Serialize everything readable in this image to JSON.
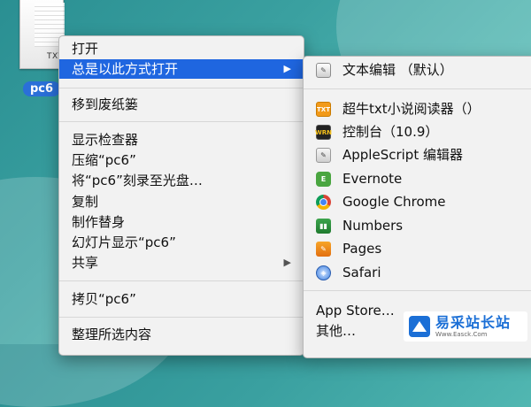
{
  "desktop": {
    "file_ext": "TXT",
    "file_label": "pc6"
  },
  "context_menu": {
    "items": [
      {
        "label": "打开"
      },
      {
        "label": "总是以此方式打开",
        "has_submenu": true,
        "active": true
      },
      {
        "label": "移到废纸篓"
      },
      {
        "label": "显示检查器"
      },
      {
        "label": "压缩“pc6”"
      },
      {
        "label": "将“pc6”刻录至光盘…"
      },
      {
        "label": "复制"
      },
      {
        "label": "制作替身"
      },
      {
        "label": "幻灯片显示“pc6”"
      },
      {
        "label": "共享",
        "has_submenu": true
      },
      {
        "label": "拷贝“pc6”"
      },
      {
        "label": "整理所选内容"
      }
    ],
    "arrow_glyph": "▶"
  },
  "submenu": {
    "items": [
      {
        "label": "文本编辑 （默认）",
        "icon": "textedit-icon"
      },
      {
        "label": "超牛txt小说阅读器（）",
        "icon": "txt-reader-icon",
        "icon_text": "TXT"
      },
      {
        "label": "控制台（10.9）",
        "icon": "console-icon",
        "icon_text": "WRN"
      },
      {
        "label": "AppleScript 编辑器",
        "icon": "applescript-icon",
        "icon_text": "✎"
      },
      {
        "label": "Evernote",
        "icon": "evernote-icon",
        "icon_text": "E"
      },
      {
        "label": "Google Chrome",
        "icon": "chrome-icon"
      },
      {
        "label": "Numbers",
        "icon": "numbers-icon",
        "icon_text": "▮▮"
      },
      {
        "label": "Pages",
        "icon": "pages-icon",
        "icon_text": "✎"
      },
      {
        "label": "Safari",
        "icon": "safari-icon",
        "icon_text": "◈"
      },
      {
        "label": "App Store…"
      },
      {
        "label": "其他…"
      }
    ]
  },
  "watermark": {
    "title": "易采站长站",
    "subtitle": "Www.Easck.Com"
  },
  "colors": {
    "highlight": "#1f66e0",
    "desktop": "#3aa0a0"
  }
}
